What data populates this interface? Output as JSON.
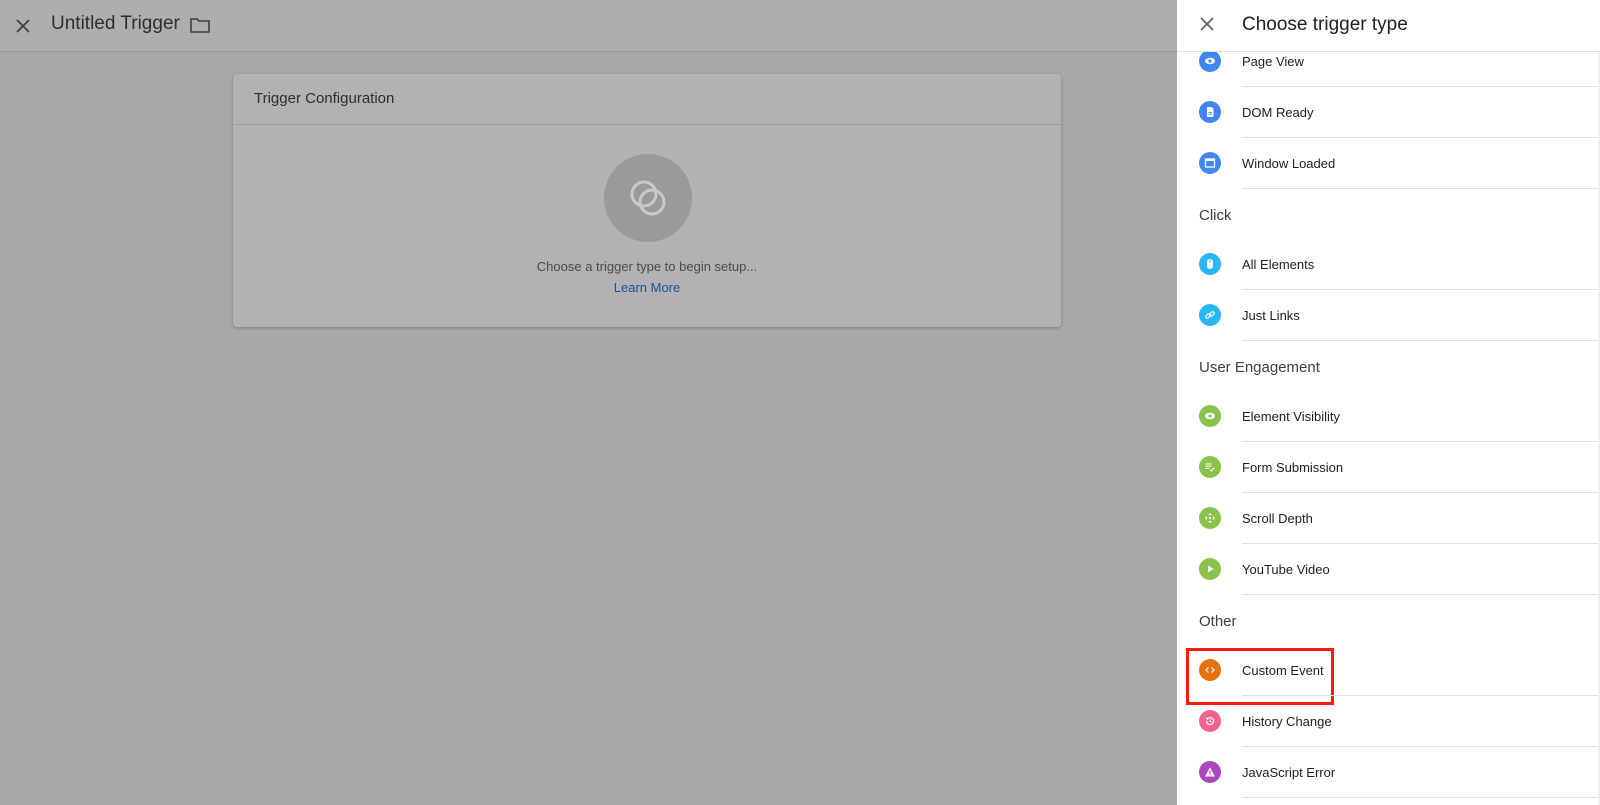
{
  "topbar": {
    "title": "Untitled Trigger"
  },
  "card": {
    "title": "Trigger Configuration",
    "hint": "Choose a trigger type to begin setup...",
    "learn_more": "Learn More"
  },
  "panel": {
    "title": "Choose trigger type",
    "page_view": "Page View",
    "dom_ready": "DOM Ready",
    "window_loaded": "Window Loaded",
    "section_click": "Click",
    "all_elements": "All Elements",
    "just_links": "Just Links",
    "section_engagement": "User Engagement",
    "element_visibility": "Element Visibility",
    "form_submission": "Form Submission",
    "scroll_depth": "Scroll Depth",
    "youtube_video": "YouTube Video",
    "section_other": "Other",
    "custom_event": "Custom Event",
    "history_change": "History Change",
    "javascript_error": "JavaScript Error"
  },
  "colors": {
    "pageview_blue": "#4285f4",
    "click_lightblue": "#29b6f6",
    "engagement_green": "#8bc34a",
    "custom_orange": "#e8710a",
    "history_pink": "#f06292",
    "js_purple": "#ab47bc",
    "highlight_red": "#ff1a0a"
  },
  "icons": {
    "close": "close-icon",
    "folder": "folder-icon",
    "trigger_placeholder": "trigger-circles-icon"
  }
}
